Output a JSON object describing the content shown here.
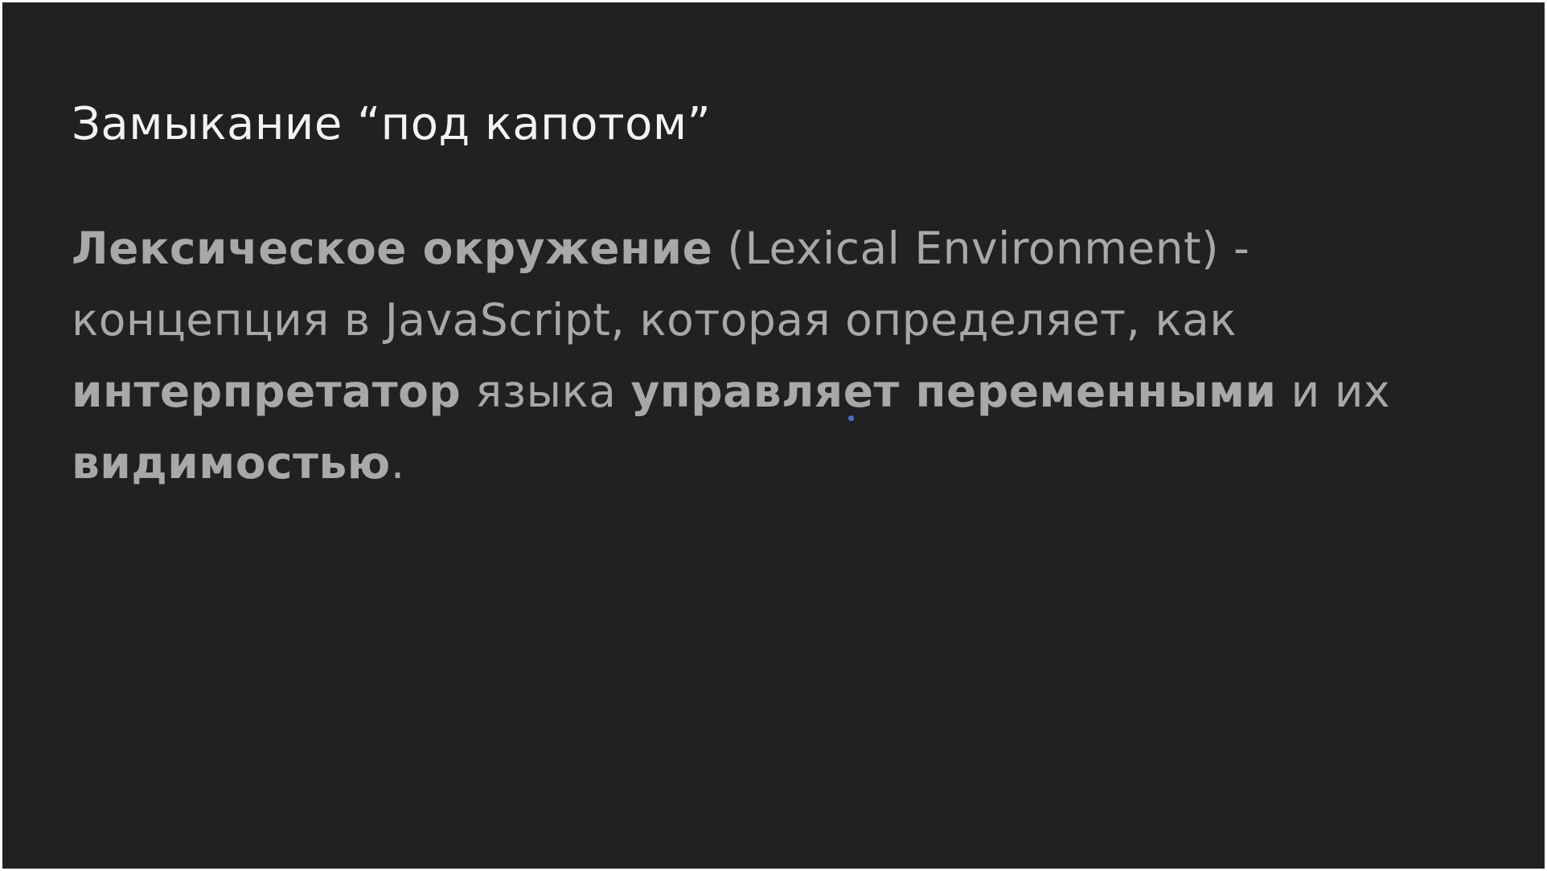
{
  "slide": {
    "title": "Замыкание “под капотом”",
    "definition": {
      "term": "Лексическое окружение",
      "term_english": "(Lexical Environment) -",
      "text_1": "концепция в JavaScript, которая определяет, как",
      "bold_1": "интерпретатор",
      "text_2": "языка",
      "bold_2": "управляет переменными",
      "text_3": "и",
      "text_4": "их",
      "bold_3": "видимостью",
      "end": "."
    }
  },
  "colors": {
    "background": "#212121",
    "title_text": "#f2f2f2",
    "body_text": "#a8a8a8",
    "pointer_dot": "#3f6fd9"
  }
}
